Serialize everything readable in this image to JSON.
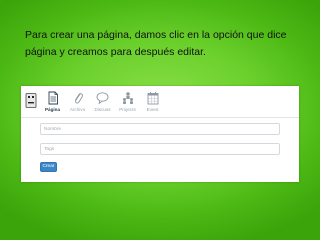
{
  "caption": "Para crear una página, damos clic en la opción que dice página y creamos para después editar.",
  "toolbar": {
    "app_icon": "robot-icon",
    "tools": [
      {
        "label": "Página",
        "icon": "page-icon",
        "active": true
      },
      {
        "label": "Archivo",
        "icon": "paperclip-icon",
        "active": false
      },
      {
        "label": "Discuss",
        "icon": "speech-bubble-icon",
        "active": false
      },
      {
        "label": "Projects",
        "icon": "people-icon",
        "active": false
      },
      {
        "label": "Event",
        "icon": "calendar-icon",
        "active": false
      }
    ]
  },
  "form": {
    "name_placeholder": "Nombre",
    "tags_placeholder": "Tags",
    "submit_label": "Crear"
  },
  "colors": {
    "background": "#5cc61e",
    "button": "#3a87c8"
  }
}
